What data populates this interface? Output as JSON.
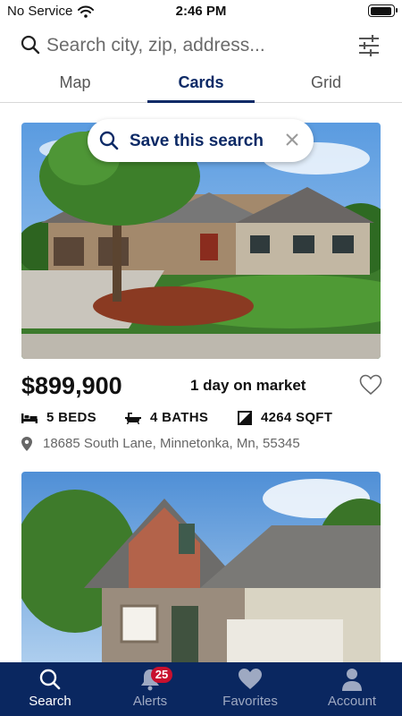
{
  "status_bar": {
    "carrier": "No Service",
    "time": "2:46 PM"
  },
  "search": {
    "placeholder": "Search city, zip, address..."
  },
  "tabs": [
    {
      "label": "Map"
    },
    {
      "label": "Cards"
    },
    {
      "label": "Grid"
    }
  ],
  "active_tab": "Cards",
  "save_search": {
    "label": "Save this search"
  },
  "listings": [
    {
      "price": "$899,900",
      "days_on_market": "1 day on market",
      "beds": "5 BEDS",
      "baths": "4 BATHS",
      "sqft": "4264 SQFT",
      "address": "18685 South Lane, Minnetonka, Mn, 55345"
    }
  ],
  "bottom_nav": [
    {
      "label": "Search",
      "icon": "search-icon"
    },
    {
      "label": "Alerts",
      "icon": "bell-icon",
      "badge": "25"
    },
    {
      "label": "Favorites",
      "icon": "heart-icon"
    },
    {
      "label": "Account",
      "icon": "person-icon"
    }
  ],
  "colors": {
    "brand": "#0a2760",
    "accent": "#0d2a66",
    "badge": "#c8102e"
  }
}
